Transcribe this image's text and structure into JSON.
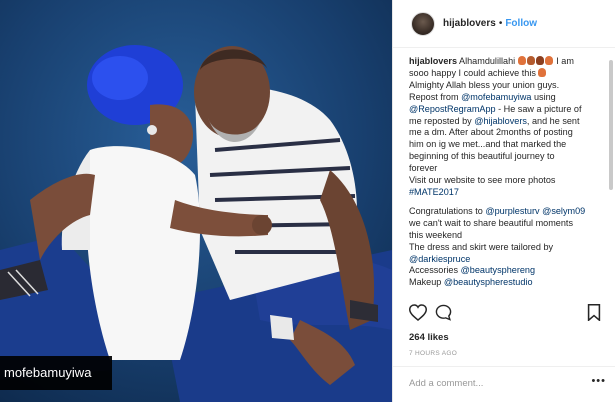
{
  "post": {
    "username": "hijablovers",
    "separator": "•",
    "follow_label": "Follow",
    "watermark_text": "mofebamuyiwa",
    "caption_lines": [
      {
        "segments": [
          {
            "t": "hijablovers",
            "c": "u"
          },
          {
            "t": " Alhamdulillahi ",
            "c": ""
          },
          {
            "t": "",
            "c": "emoji"
          },
          {
            "t": " I am",
            "c": ""
          }
        ]
      },
      {
        "segments": [
          {
            "t": "sooo happy I could achieve this ",
            "c": ""
          },
          {
            "t": "",
            "c": "emoji1"
          }
        ]
      },
      {
        "segments": [
          {
            "t": "Almighty Allah bless your union guys.",
            "c": ""
          }
        ]
      },
      {
        "segments": [
          {
            "t": "Repost from ",
            "c": ""
          },
          {
            "t": "@mofebamuyiwa",
            "c": "lnk"
          },
          {
            "t": " using",
            "c": ""
          }
        ]
      },
      {
        "segments": [
          {
            "t": "@RepostRegramApp",
            "c": "lnk"
          },
          {
            "t": " - He saw a picture of",
            "c": ""
          }
        ]
      },
      {
        "segments": [
          {
            "t": "me reposted by ",
            "c": ""
          },
          {
            "t": "@hijablovers",
            "c": "lnk"
          },
          {
            "t": ", and he sent",
            "c": ""
          }
        ]
      },
      {
        "segments": [
          {
            "t": "me a dm. After about 2months of posting",
            "c": ""
          }
        ]
      },
      {
        "segments": [
          {
            "t": "him on ig we met...and that marked the",
            "c": ""
          }
        ]
      },
      {
        "segments": [
          {
            "t": "beginning of this beautiful journey to",
            "c": ""
          }
        ]
      },
      {
        "segments": [
          {
            "t": "forever",
            "c": ""
          }
        ]
      },
      {
        "segments": [
          {
            "t": "Visit our website to see more photos",
            "c": ""
          }
        ]
      },
      {
        "segments": [
          {
            "t": "#MATE2017",
            "c": "lnk"
          }
        ]
      },
      {
        "gap": true
      },
      {
        "segments": [
          {
            "t": "Congratulations to ",
            "c": ""
          },
          {
            "t": "@purplesturv",
            "c": "lnk"
          },
          {
            "t": " ",
            "c": ""
          },
          {
            "t": "@selym09",
            "c": "lnk"
          }
        ]
      },
      {
        "segments": [
          {
            "t": "we can't wait to share beautiful moments",
            "c": ""
          }
        ]
      },
      {
        "segments": [
          {
            "t": "this weekend",
            "c": ""
          }
        ]
      },
      {
        "segments": [
          {
            "t": "The dress and skirt were tailored by",
            "c": ""
          }
        ]
      },
      {
        "segments": [
          {
            "t": "@darkiespruce",
            "c": "lnk"
          }
        ]
      },
      {
        "segments": [
          {
            "t": "Accessories ",
            "c": ""
          },
          {
            "t": "@beautysphereng",
            "c": "lnk"
          }
        ]
      },
      {
        "segments": [
          {
            "t": "Makeup ",
            "c": ""
          },
          {
            "t": "@beautyspherestudio",
            "c": "lnk"
          }
        ]
      }
    ],
    "likes_label": "264 likes",
    "time_label": "7 HOURS AGO",
    "comment_placeholder": "Add a comment...",
    "more_label": "•••"
  },
  "icons": {
    "like": "heart-icon",
    "comment": "comment-icon",
    "save": "bookmark-icon"
  },
  "colors": {
    "link": "#003569",
    "follow": "#3897f0",
    "photo_bg": "#173e6d",
    "hijab": "#1f3fd6"
  }
}
